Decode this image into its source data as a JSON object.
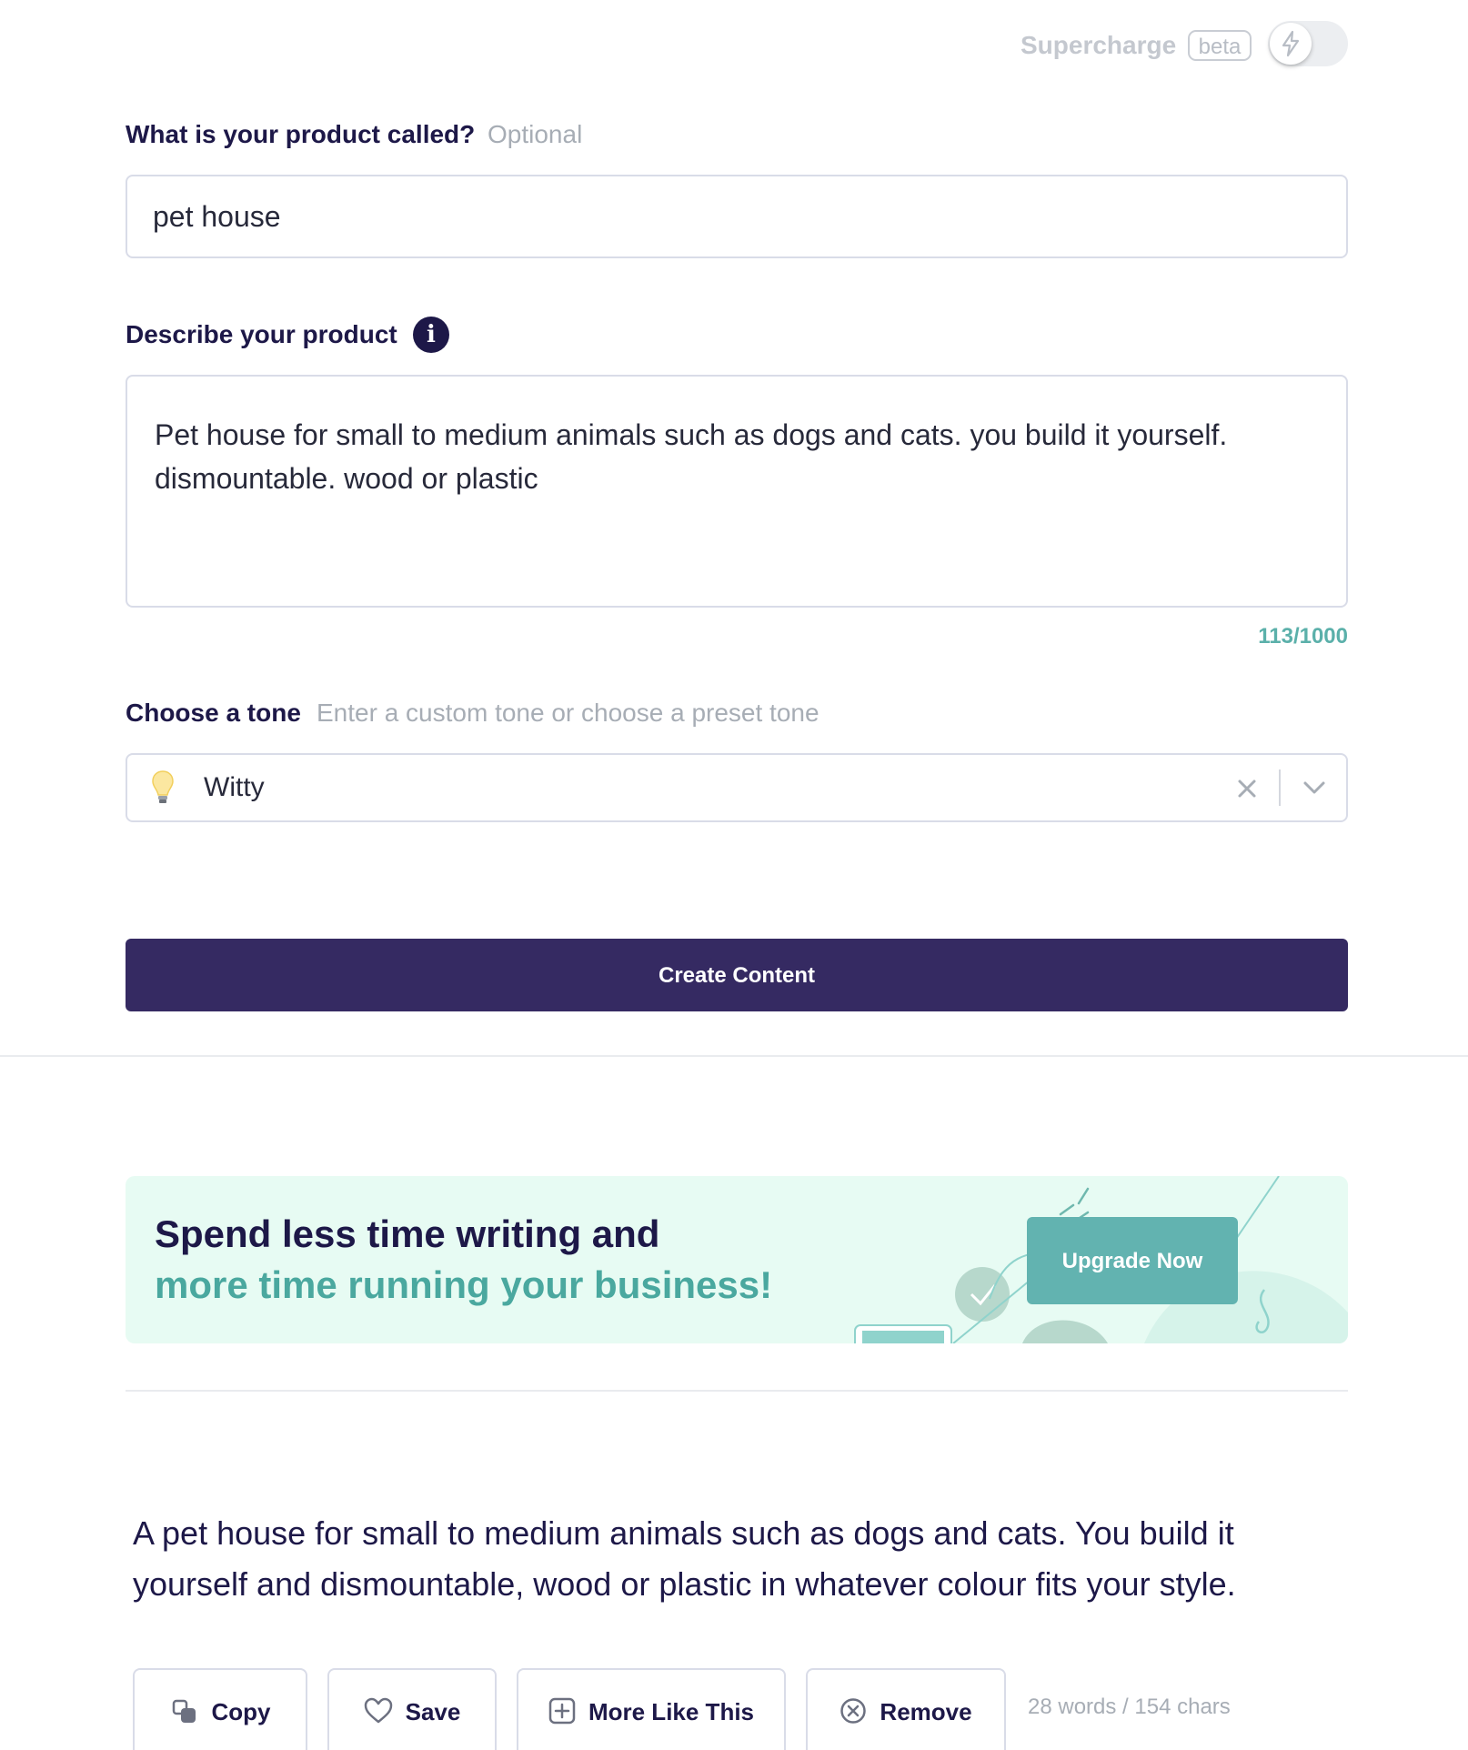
{
  "supercharge": {
    "label": "Supercharge",
    "badge": "beta",
    "enabled": false
  },
  "product_name": {
    "label": "What is your product called?",
    "hint": "Optional",
    "value": "pet house"
  },
  "description": {
    "label": "Describe your product",
    "value": "Pet house for small to medium animals such as dogs and cats. you build it yourself. dismountable. wood or plastic",
    "counter": "113/1000"
  },
  "tone": {
    "label": "Choose a tone",
    "hint": "Enter a custom tone or choose a preset tone",
    "value": "Witty"
  },
  "create_button": "Create Content",
  "banner": {
    "line1": "Spend less time writing and",
    "line2": "more time running your business!",
    "button": "Upgrade Now"
  },
  "result": {
    "text": "A pet house for small to medium animals such as dogs and cats. You build it yourself and dismountable, wood or plastic in whatever colour fits your style.",
    "actions": {
      "copy": "Copy",
      "save": "Save",
      "more": "More Like This",
      "remove": "Remove"
    },
    "stats": "28 words / 154 chars"
  },
  "colors": {
    "primary": "#352a62",
    "navy_text": "#1d1848",
    "teal": "#4aa89f",
    "upgrade": "#62b3b0",
    "banner_bg": "#e7fbf3"
  }
}
